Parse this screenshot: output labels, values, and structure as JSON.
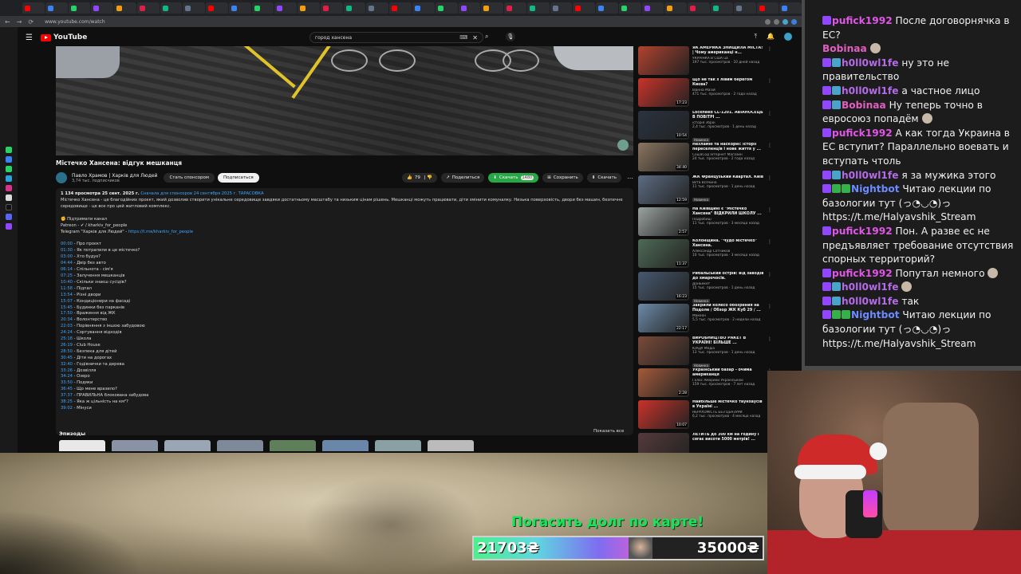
{
  "browser": {
    "url": "www.youtube.com/watch",
    "tabs_count": 34
  },
  "youtube": {
    "logo": "YouTube",
    "search": {
      "value": "город хансена",
      "kbd": "⌨"
    },
    "video": {
      "title": "Містечко Хансена: відгук мешканця",
      "channel": "Павло Храмов | Харків для Людей",
      "subscribers": "3,74 тыс. подписчиков",
      "sponsor_label": "Стать спонсором",
      "subscribe_label": "Подписаться",
      "likes": "79",
      "share_label": "Поделиться",
      "download_label": "Скачать",
      "download_count": "1480",
      "save_label": "Сохранить",
      "clip_label": "Скачать"
    },
    "description": {
      "meta": "1 134 просмотра  25 сент. 2025 г.",
      "meta_tag": "Сначала для спонсоров 24 сентября 2025 г.  ТАРАСОВКА",
      "text": "Містечко Хансена - це благодійних проєкт, який дозволив створити унікальне середовище завдяки достатньому масштабу та низьким цінам рішень. Мешканці можуть працювати, діти змінити комуналку. Низька поверховість, двори без машин, безпечне середовище - це все про цей житловий комплекс.",
      "support": "✊ Підтримати канал",
      "patreon": "Patreon -  ✔ / kharkiv_for_people",
      "telegram_label": "Telegram \"Харків для Людей\" - ",
      "telegram_link": "https://t.me/kharkiv_for_people",
      "chapters": [
        {
          "t": "00:00",
          "l": "Про проєкт"
        },
        {
          "t": "01:30",
          "l": "Як потрапили в це містечко?"
        },
        {
          "t": "03:00",
          "l": "Хто будує?"
        },
        {
          "t": "04:44",
          "l": "Двір без авто"
        },
        {
          "t": "06:14",
          "l": "Спільнота - сім'я"
        },
        {
          "t": "07:25",
          "l": "Залучення мешканців"
        },
        {
          "t": "10:40",
          "l": "Скільки знаєш сусідів?"
        },
        {
          "t": "11:58",
          "l": "Підпал"
        },
        {
          "t": "13:54",
          "l": "Різні двори"
        },
        {
          "t": "15:07",
          "l": "Кондиціонери на фасаді"
        },
        {
          "t": "15:45",
          "l": "Будинки без парканів"
        },
        {
          "t": "17:50",
          "l": "Враження від ЖК"
        },
        {
          "t": "20:34",
          "l": "Волонтерство"
        },
        {
          "t": "22:03",
          "l": "Порівняння з іншою забудовою"
        },
        {
          "t": "24:24",
          "l": "Сортування відходів"
        },
        {
          "t": "25:18",
          "l": "Школа"
        },
        {
          "t": "26:19",
          "l": "Club House"
        },
        {
          "t": "28:50",
          "l": "Безпека для дітей"
        },
        {
          "t": "30:45",
          "l": "Діти на дорогах"
        },
        {
          "t": "32:40",
          "l": "Годівнички та дерева"
        },
        {
          "t": "33:26",
          "l": "Дозвілля"
        },
        {
          "t": "34:24",
          "l": "Озеро"
        },
        {
          "t": "33:50",
          "l": "Подяки"
        },
        {
          "t": "36:45",
          "l": "Що мене вразило?"
        },
        {
          "t": "37:37",
          "l": "ПРАВИЛЬНА блокована забудова"
        },
        {
          "t": "38:25",
          "l": "Яка ж цільність на км²?"
        },
        {
          "t": "39:02",
          "l": "Мінуси"
        }
      ]
    },
    "episodes_label": "Эпизоды",
    "show_all_label": "Показать все",
    "recommendations": [
      {
        "title": "ЯК АМЕРИКА ЗНИЩИЛА МІСТА! | Чому американці н...",
        "channel": "УКРАЇНКА В США ua",
        "meta": "197 тыс. просмотров · 10 дней назад",
        "color": "#b1432f",
        "duration": ""
      },
      {
        "title": "Що не так з лівим берегом Києва?",
        "channel": "Іванна Мазій",
        "meta": "471 тыс. просмотров · 2 года назад",
        "color": "#c9342a",
        "duration": "17:23"
      },
      {
        "title": "Lockheed CL-1201. АВІАНОСЕЦЬ В ПОВІТРІ ...",
        "channel": "історія Зброї",
        "meta": "2,4 тыс. просмотров · 1 день назад",
        "color": "#2a3340",
        "duration": "10:54",
        "badge": "Новинка"
      },
      {
        "title": "Незламні та наскорні: історії переселенців і нове життя у ...",
        "channel": "СоціаСод Інтернет Магазин",
        "meta": "24 тыс. просмотров · 2 года назад",
        "color": "#8a7560",
        "duration": "34:40"
      },
      {
        "title": "ЖК Французький Квартал. Київ",
        "channel": "Вєта Всячина",
        "meta": "11 тыс. просмотров · 1 день назад",
        "color": "#5c6c82",
        "duration": "12:59",
        "badge": "Новинка"
      },
      {
        "title": "На Київщині є \"Містечко Хансена\" ВІДКРИЛИ ШКОЛУ ...",
        "channel": "Подробиці",
        "meta": "11 тыс. просмотров · 3 месяца назад",
        "color": "#9aa2a0",
        "duration": "2:57"
      },
      {
        "title": "Колонщина. \"Чудо містечко\" Хансена.",
        "channel": "Александр Сотников",
        "meta": "10 тыс. просмотров · 3 месяца назад",
        "color": "#4f6a55",
        "duration": "11:37"
      },
      {
        "title": "Рибальський острів: від заводів до хмарочосів.",
        "channel": "ДонБекет",
        "meta": "15 тыс. просмотров · 1 день назад",
        "color": "#46586e",
        "duration": "16:23",
        "badge": "Новинка"
      },
      {
        "title": "Закрили колесо обозрения на Подоле / Обзор ЖК Куб 29 / ...",
        "channel": "Макеон",
        "meta": "5,5 тыс. просмотров · 2 недели назад",
        "color": "#6c8aa8",
        "duration": "22:17"
      },
      {
        "title": "ВИРОБНИЦТВО РАКЕТ В УКРАЇНІ! БІЛЬШЕ ...",
        "channel": "ЮАДУ Медіа",
        "meta": "13 тыс. просмотров · 1 день назад",
        "color": "#7a4a3a",
        "duration": "",
        "badge": "Новинка"
      },
      {
        "title": "Український базар - очима американця",
        "channel": "Голос Америки Українською",
        "meta": "159 тыс. просмотров · 7 лет назад",
        "color": "#a35a3a",
        "duration": "2:28"
      },
      {
        "title": "Найбільше містечко таунхаусів в Україні ...",
        "channel": "НЕРУХОМІСТЬ БЕЗ ЦЕНЗУРИ",
        "meta": "6,2 тыс. просмотров · 4 месяца назад",
        "color": "#c9332a",
        "duration": "10:07"
      },
      {
        "title": "ЛЕТИТЬ до 300 км на годину і сягає висоти 5000 метрів! ...",
        "channel": "",
        "meta": "",
        "color": "#553a3a",
        "duration": ""
      }
    ]
  },
  "chat": {
    "messages": [
      {
        "user": "pufick1992",
        "color": "#e056e6",
        "badges": [
          "#9147ff"
        ],
        "text": " После договорнячка в ЕС?"
      },
      {
        "user": "Bobinaa",
        "color": "#e05fc0",
        "badges": [],
        "text": " ",
        "emote": true
      },
      {
        "user": "h0ll0wl1fe",
        "color": "#b46be8",
        "badges": [
          "#9147ff",
          "#4aa3c8"
        ],
        "text": " ну это не правительство"
      },
      {
        "user": "h0ll0wl1fe",
        "color": "#b46be8",
        "badges": [
          "#9147ff",
          "#4aa3c8"
        ],
        "text": " а частное лицо"
      },
      {
        "user": "Bobinaa",
        "color": "#e05fc0",
        "badges": [
          "#9147ff",
          "#4aa3c8"
        ],
        "text": " Ну теперь точно в евросоюз попадём ",
        "emote": true
      },
      {
        "user": "pufick1992",
        "color": "#e056e6",
        "badges": [
          "#9147ff"
        ],
        "text": " А как тогда Украина в ЕС вступит? Параллельно воевать и вступать чтоль"
      },
      {
        "user": "h0ll0wl1fe",
        "color": "#b46be8",
        "badges": [
          "#9147ff",
          "#4aa3c8"
        ],
        "text": " я за мужика этого"
      },
      {
        "user": "Nightbot",
        "color": "#6b8cff",
        "badges": [
          "#9147ff",
          "#35b04a",
          "#35b04a"
        ],
        "text": " Читаю лекции по базологии тут (っ◔◡◔)っ https://t.me/Halyavshik_Stream"
      },
      {
        "user": "pufick1992",
        "color": "#e056e6",
        "badges": [
          "#9147ff"
        ],
        "text": " Пон. А разве ес не предъявляет требование отсутствия спорных территорий?"
      },
      {
        "user": "pufick1992",
        "color": "#e056e6",
        "badges": [
          "#9147ff"
        ],
        "text": " Попутал немного ",
        "emote": true
      },
      {
        "user": "h0ll0wl1fe",
        "color": "#b46be8",
        "badges": [
          "#9147ff",
          "#4aa3c8"
        ],
        "text": " ",
        "emote": true
      },
      {
        "user": "h0ll0wl1fe",
        "color": "#b46be8",
        "badges": [
          "#9147ff",
          "#4aa3c8"
        ],
        "text": " так"
      },
      {
        "user": "Nightbot",
        "color": "#6b8cff",
        "badges": [
          "#9147ff",
          "#35b04a",
          "#35b04a"
        ],
        "text": " Читаю лекции по базологии тут (っ◔◡◔)っ https://t.me/Halyavshik_Stream"
      }
    ]
  },
  "donation_goal": {
    "title": "Погасить долг по карте!",
    "current": "21703₴",
    "target": "35000₴",
    "progress": 0.62
  }
}
